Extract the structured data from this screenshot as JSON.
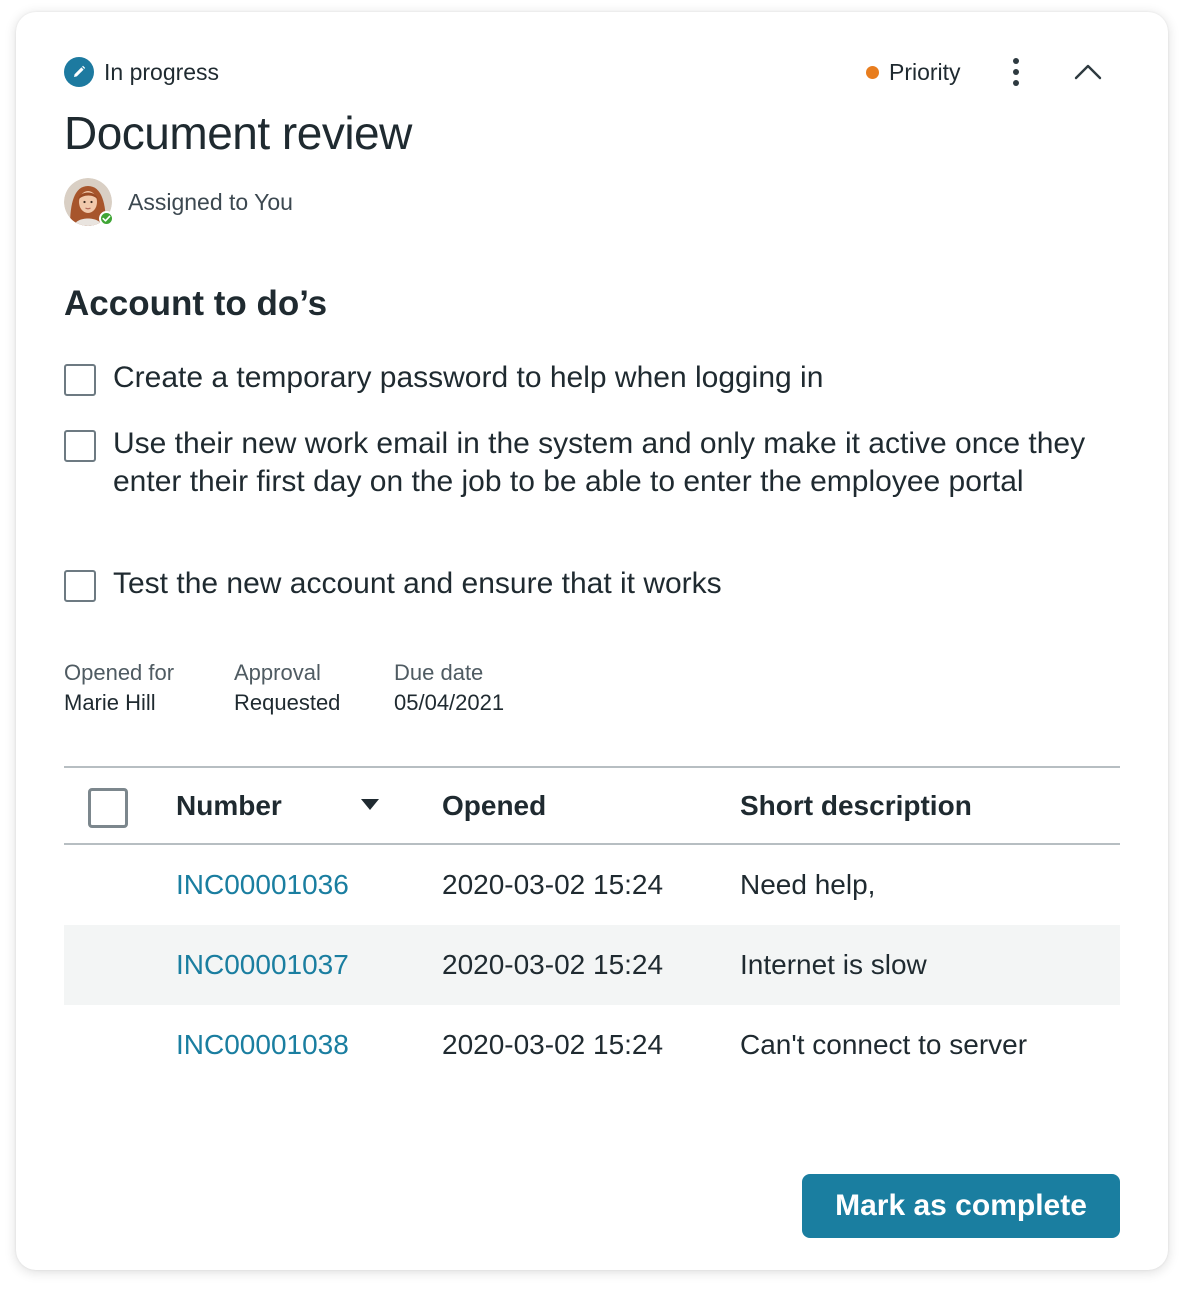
{
  "header": {
    "status_icon": "pencil-icon",
    "status_label": "In progress",
    "priority_label": "Priority",
    "priority_color": "#e87d1e",
    "more_icon": "more-vertical-icon",
    "collapse_icon": "chevron-up-icon"
  },
  "task": {
    "title": "Document review",
    "assignee_label": "Assigned to You",
    "assignee_status_color": "#3fa535"
  },
  "todos": {
    "heading": "Account to do’s",
    "items": [
      {
        "label": "Create a temporary password to help when logging in",
        "checked": false
      },
      {
        "label": "Use their new work email in the system and only make it active once they enter their first day on the job to be able to enter the employee portal",
        "checked": false
      },
      {
        "label": "Test the new account and ensure that it works",
        "checked": false
      }
    ]
  },
  "meta": {
    "opened_for_label": "Opened for",
    "opened_for_value": "Marie Hill",
    "approval_label": "Approval",
    "approval_value": "Requested",
    "due_date_label": "Due date",
    "due_date_value": "05/04/2021"
  },
  "table": {
    "columns": [
      "Number",
      "Opened",
      "Short description"
    ],
    "sort_icon": "caret-down-icon",
    "rows": [
      {
        "number": "INC00001036",
        "opened": "2020-03-02 15:24",
        "description": "Need help,"
      },
      {
        "number": "INC00001037",
        "opened": "2020-03-02 15:24",
        "description": "Internet is slow"
      },
      {
        "number": "INC00001038",
        "opened": "2020-03-02 15:24",
        "description": "Can't connect to server"
      }
    ]
  },
  "actions": {
    "complete_label": "Mark as complete",
    "accent_color": "#1a7ea0"
  }
}
